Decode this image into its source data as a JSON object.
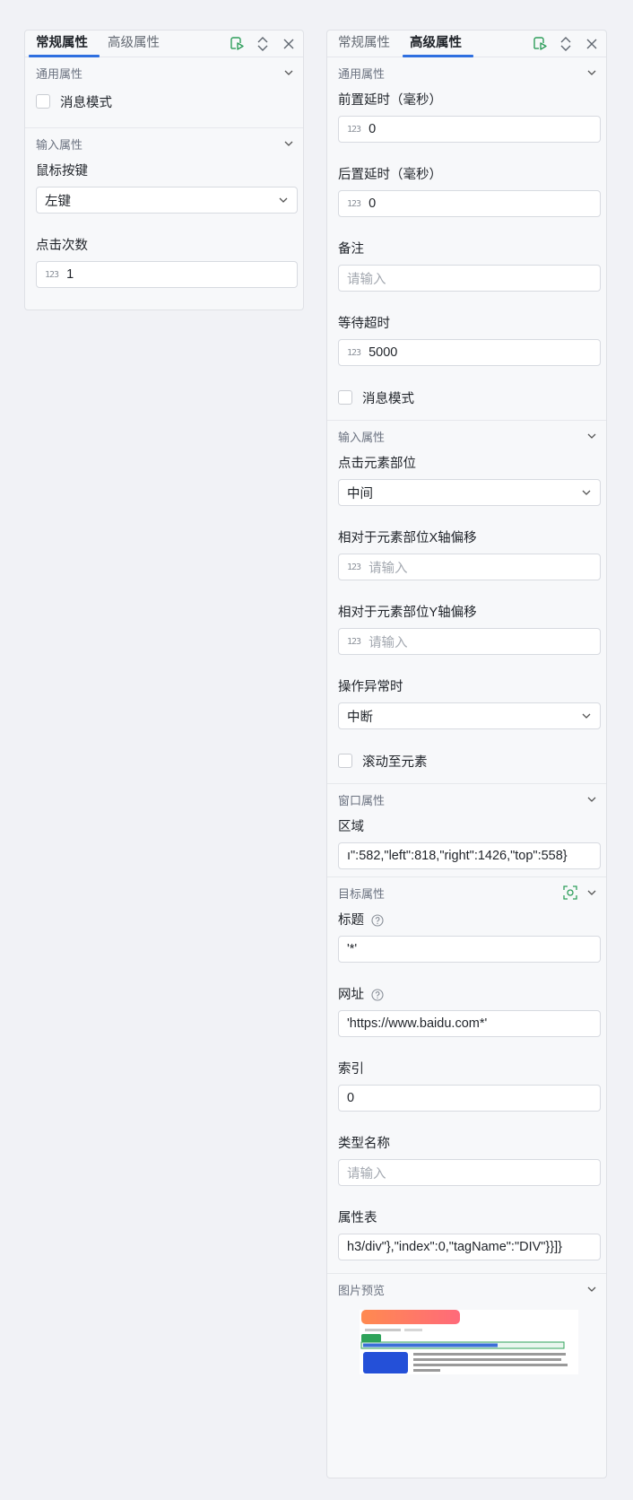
{
  "left_panel": {
    "tabs": [
      "常规属性",
      "高级属性"
    ],
    "active_tab": "常规属性",
    "icons": [
      "run-icon",
      "expand-collapse-icon",
      "close-icon"
    ],
    "sections": {
      "general": {
        "title": "通用属性",
        "message_mode": "消息模式"
      },
      "input": {
        "title": "输入属性",
        "mouse_button_label": "鼠标按键",
        "mouse_button_value": "左键",
        "click_count_label": "点击次数",
        "click_count_value": "1"
      }
    }
  },
  "right_panel": {
    "tabs": [
      "常规属性",
      "高级属性"
    ],
    "active_tab": "高级属性",
    "icons": [
      "run-icon",
      "expand-collapse-icon",
      "close-icon"
    ],
    "sections": {
      "general": {
        "title": "通用属性",
        "pre_delay_label": "前置延时（毫秒）",
        "pre_delay_value": "0",
        "post_delay_label": "后置延时（毫秒）",
        "post_delay_value": "0",
        "remark_label": "备注",
        "remark_placeholder": "请输入",
        "wait_timeout_label": "等待超时",
        "wait_timeout_value": "5000",
        "message_mode": "消息模式"
      },
      "input": {
        "title": "输入属性",
        "click_position_label": "点击元素部位",
        "click_position_value": "中间",
        "x_offset_label": "相对于元素部位X轴偏移",
        "x_offset_placeholder": "请输入",
        "y_offset_label": "相对于元素部位Y轴偏移",
        "y_offset_placeholder": "请输入",
        "error_action_label": "操作异常时",
        "error_action_value": "中断",
        "scroll_to_element": "滚动至元素"
      },
      "window": {
        "title": "窗口属性",
        "region_label": "区域",
        "region_value": "ı\":582,\"left\":818,\"right\":1426,\"top\":558}"
      },
      "target": {
        "title": "目标属性",
        "title_label": "标题",
        "title_value": "'*'",
        "url_label": "网址",
        "url_value": "'https://www.baidu.com*'",
        "index_label": "索引",
        "index_value": "0",
        "type_name_label": "类型名称",
        "type_name_placeholder": "请输入",
        "attr_table_label": "属性表",
        "attr_table_value": "h3/div\"},\"index\":0,\"tagName\":\"DIV\"}}]}"
      },
      "preview": {
        "title": "图片预览"
      }
    }
  },
  "colors": {
    "accent": "#2f6fe0",
    "run_icon": "#2e9e5b",
    "page_bg": "#f1f2f6"
  }
}
